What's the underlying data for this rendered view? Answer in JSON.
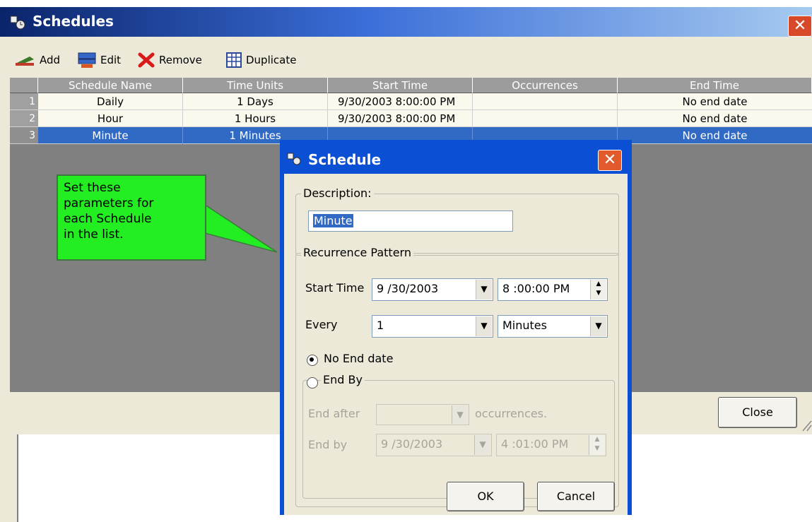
{
  "window": {
    "title": "Schedules",
    "close_glyph": "✕",
    "title_icon": "schedules-icon"
  },
  "toolbar": {
    "add_label": "Add",
    "edit_label": "Edit",
    "remove_label": "Remove",
    "duplicate_label": "Duplicate"
  },
  "grid": {
    "columns": [
      "Schedule Name",
      "Time Units",
      "Start Time",
      "Occurrences",
      "End Time"
    ],
    "rows": [
      {
        "num": "1",
        "name": "Daily",
        "units": "1 Days",
        "start": "9/30/2003 8:00:00 PM",
        "occ": "",
        "end": "No end date"
      },
      {
        "num": "2",
        "name": "Hour",
        "units": "1 Hours",
        "start": "9/30/2003 8:00:00 PM",
        "occ": "",
        "end": "No end date"
      },
      {
        "num": "3",
        "name": "Minute",
        "units": "1 Minutes",
        "start": "",
        "occ": "",
        "end": "No end date"
      }
    ],
    "selected_row": 3
  },
  "callout": {
    "text_line1": "Set these",
    "text_line2": "parameters for",
    "text_line3": "each Schedule",
    "text_line4": "in the list."
  },
  "close_button": "Close",
  "dialog": {
    "title": "Schedule",
    "close_glyph": "✕",
    "description_group": "Description:",
    "description_value": "Minute",
    "recurrence_group": "Recurrence Pattern",
    "start_time_label": "Start Time",
    "start_date": "9 /30/2003",
    "start_time": "8 :00:00 PM",
    "every_label": "Every",
    "every_value": "1",
    "every_unit": "Minutes",
    "no_end_label": "No End date",
    "end_by_group": "End By",
    "end_after_label": "End after",
    "end_after_value": "",
    "occurrences_label": "occurrences.",
    "end_by_label": "End by",
    "end_by_date": "9 /30/2003",
    "end_by_time": "4 :01:00 PM",
    "ok_label": "OK",
    "cancel_label": "Cancel"
  },
  "colors": {
    "selection": "#316ac5",
    "callout": "#22ee22",
    "dialog_frame": "#0b4fd4",
    "grid_background": "#808080"
  }
}
